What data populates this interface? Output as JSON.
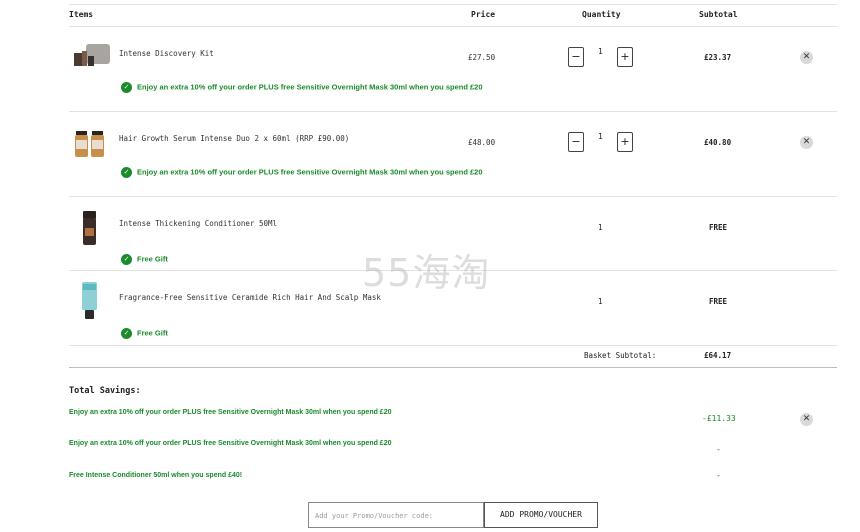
{
  "table": {
    "headers": {
      "items": "Items",
      "price": "Price",
      "quantity": "Quantity",
      "subtotal": "Subtotal"
    },
    "rows": [
      {
        "name": "Intense Discovery Kit",
        "price": "£27.50",
        "qty": "1",
        "subtotal": "£23.37",
        "promo": "Enjoy an extra 10% off your order PLUS free Sensitive Overnight Mask 30ml when you spend £20"
      },
      {
        "name": "Hair Growth Serum Intense Duo 2 x 60ml (RRP £90.00)",
        "price": "£48.00",
        "qty": "1",
        "subtotal": "£40.80",
        "promo": "Enjoy an extra 10% off your order PLUS free Sensitive Overnight Mask 30ml when you spend £20"
      },
      {
        "name": "Intense Thickening Conditioner 50Ml",
        "price": "",
        "qty": "1",
        "subtotal": "FREE",
        "promo": "Free Gift"
      },
      {
        "name": "Fragrance-Free Sensitive Ceramide Rich Hair And Scalp Mask",
        "price": "",
        "qty": "1",
        "subtotal": "FREE",
        "promo": "Free Gift"
      }
    ],
    "basket_subtotal_label": "Basket Subtotal:",
    "basket_subtotal_value": "£64.17"
  },
  "savings": {
    "title": "Total Savings:",
    "lines": [
      {
        "text": "Enjoy an extra 10% off your order PLUS free Sensitive Overnight Mask 30ml when you spend £20",
        "amount": "-£11.33"
      },
      {
        "text": "Enjoy an extra 10% off your order PLUS free Sensitive Overnight Mask 30ml when you spend £20",
        "amount": "-"
      },
      {
        "text": "Free Intense Conditioner 50ml when you spend £40!",
        "amount": "-"
      }
    ]
  },
  "promo": {
    "placeholder": "Add your Promo/Voucher code:",
    "button": "ADD PROMO/VOUCHER"
  },
  "watermark": "55海淘",
  "icons": {
    "remove": "close-icon",
    "check": "check-circle-icon",
    "minus": "minus-icon",
    "plus": "plus-icon"
  },
  "colors": {
    "promo_green": "#1a8a2a",
    "remove_bg": "#d9d9d9"
  }
}
